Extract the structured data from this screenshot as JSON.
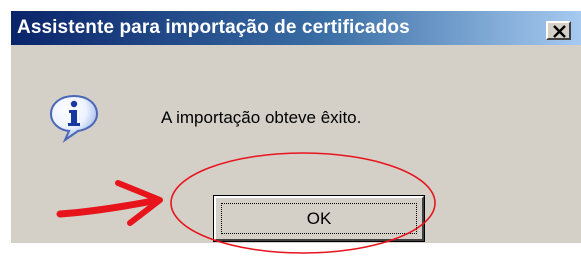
{
  "window": {
    "title": "Assistente para importação de certificados",
    "close_icon": "close-icon"
  },
  "body": {
    "icon": "info-icon",
    "message": "A importação obteve êxito."
  },
  "actions": {
    "ok_label": "OK"
  },
  "annotation": {
    "color": "#e8141c",
    "shapes": [
      "red-ellipse",
      "red-arrow"
    ]
  },
  "colors": {
    "face": "#d4d0c8",
    "title_start": "#0a246a",
    "title_end": "#a6caf0"
  }
}
